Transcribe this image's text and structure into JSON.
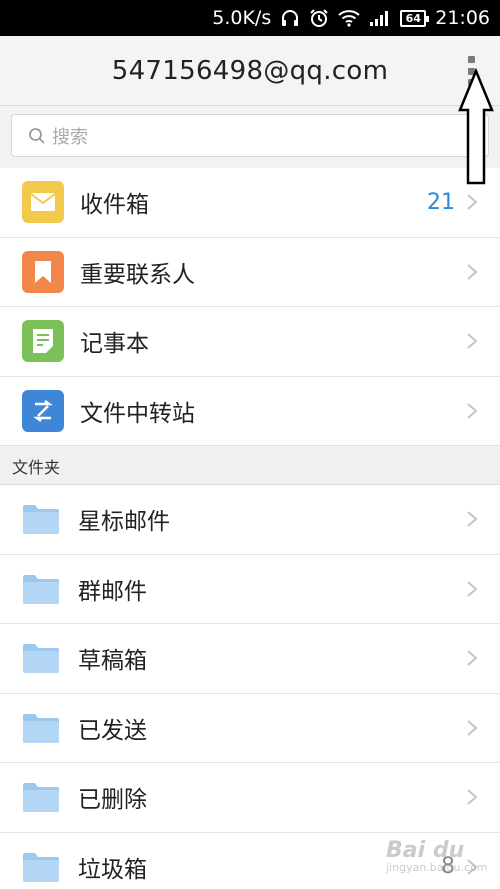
{
  "status_bar": {
    "speed": "5.0K/s",
    "battery": "64",
    "time": "21:06",
    "icons": [
      "headphones-icon",
      "alarm-icon",
      "wifi-icon",
      "signal-icon",
      "battery-icon"
    ]
  },
  "header": {
    "title": "547156498@qq.com",
    "more_icon": "more-vertical-icon"
  },
  "search": {
    "placeholder": "搜索",
    "icon": "search-icon"
  },
  "main_items": [
    {
      "label": "收件箱",
      "count": "21",
      "icon": "envelope-icon",
      "color": "#f2c94c"
    },
    {
      "label": "重要联系人",
      "count": "",
      "icon": "bookmark-icon",
      "color": "#f2874a"
    },
    {
      "label": "记事本",
      "count": "",
      "icon": "note-icon",
      "color": "#7cc05a"
    },
    {
      "label": "文件中转站",
      "count": "",
      "icon": "transfer-icon",
      "color": "#3f86d6"
    }
  ],
  "folders_section": {
    "title": "文件夹",
    "items": [
      {
        "label": "星标邮件",
        "count": ""
      },
      {
        "label": "群邮件",
        "count": ""
      },
      {
        "label": "草稿箱",
        "count": ""
      },
      {
        "label": "已发送",
        "count": ""
      },
      {
        "label": "已删除",
        "count": ""
      },
      {
        "label": "垃圾箱",
        "count": "8"
      }
    ]
  },
  "watermark": {
    "brand": "Bai du",
    "sub": "jingyan.baidu.com"
  },
  "colors": {
    "accent_count": "#2a8ad8",
    "folder": "#9cc8ee"
  }
}
